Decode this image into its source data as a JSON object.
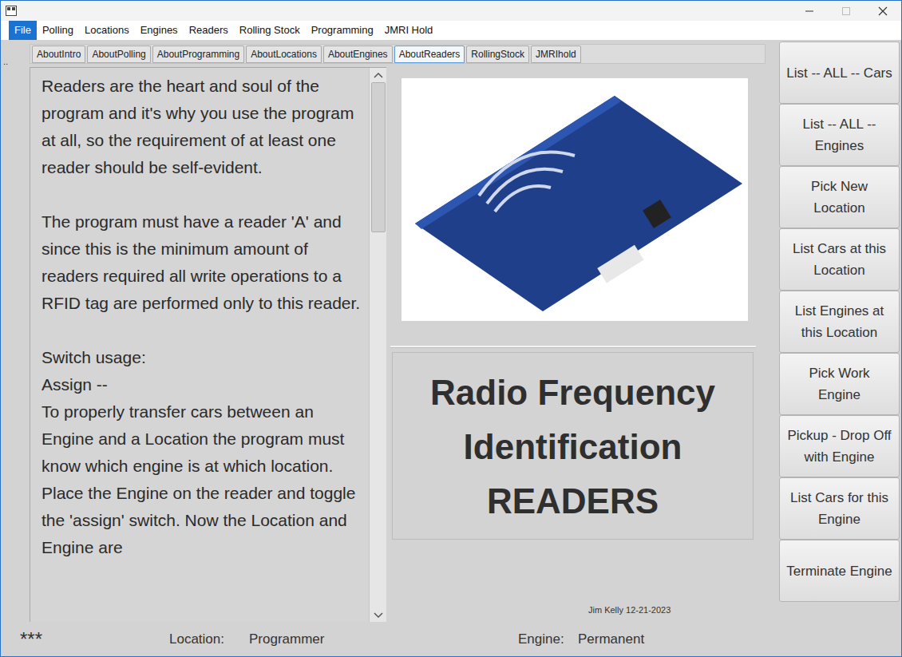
{
  "menu": [
    {
      "label": "File",
      "selected": true
    },
    {
      "label": "Polling",
      "selected": false
    },
    {
      "label": "Locations",
      "selected": false
    },
    {
      "label": "Engines",
      "selected": false
    },
    {
      "label": "Readers",
      "selected": false
    },
    {
      "label": "Rolling Stock",
      "selected": false
    },
    {
      "label": "Programming",
      "selected": false
    },
    {
      "label": "JMRI Hold",
      "selected": false
    }
  ],
  "corner_mark": "..",
  "tabs": [
    {
      "label": "AboutIntro",
      "selected": false
    },
    {
      "label": "AboutPolling",
      "selected": false
    },
    {
      "label": "AboutProgramming",
      "selected": false
    },
    {
      "label": "AboutLocations",
      "selected": false
    },
    {
      "label": "AboutEngines",
      "selected": false
    },
    {
      "label": "AboutReaders",
      "selected": true
    },
    {
      "label": "RollingStock",
      "selected": false
    },
    {
      "label": "JMRIhold",
      "selected": false
    }
  ],
  "about_text": {
    "paragraphs": [
      [
        "Readers are the heart and soul of the program and it's why you use the program at all, so the requirement of at least one reader should be self-evident."
      ],
      [
        "The program must have a reader 'A' and since this is the minimum amount of readers required all write operations to a RFID tag are performed only to this reader."
      ],
      [
        "Switch usage:",
        "Assign --",
        "To properly transfer cars between an Engine and a Location the program must know which engine is at which location. Place the Engine on the reader and toggle the 'assign' switch. Now the Location and Engine are"
      ]
    ]
  },
  "heading": {
    "lines": [
      "Radio Frequency",
      "Identification",
      "READERS"
    ]
  },
  "credit": "Jim Kelly 12-21-2023",
  "actions": [
    "List -- ALL -- Cars",
    "List -- ALL -- Engines",
    "Pick New Location",
    "List Cars at this Location",
    "List Engines at this Location",
    "Pick Work Engine",
    "Pickup - Drop Off with Engine",
    "List Cars for this Engine",
    "Terminate Engine"
  ],
  "status_bar": {
    "mark": "***",
    "location_label": "Location:",
    "location": "Programmer",
    "engine_label": "Engine:",
    "engine": "Permanent"
  }
}
